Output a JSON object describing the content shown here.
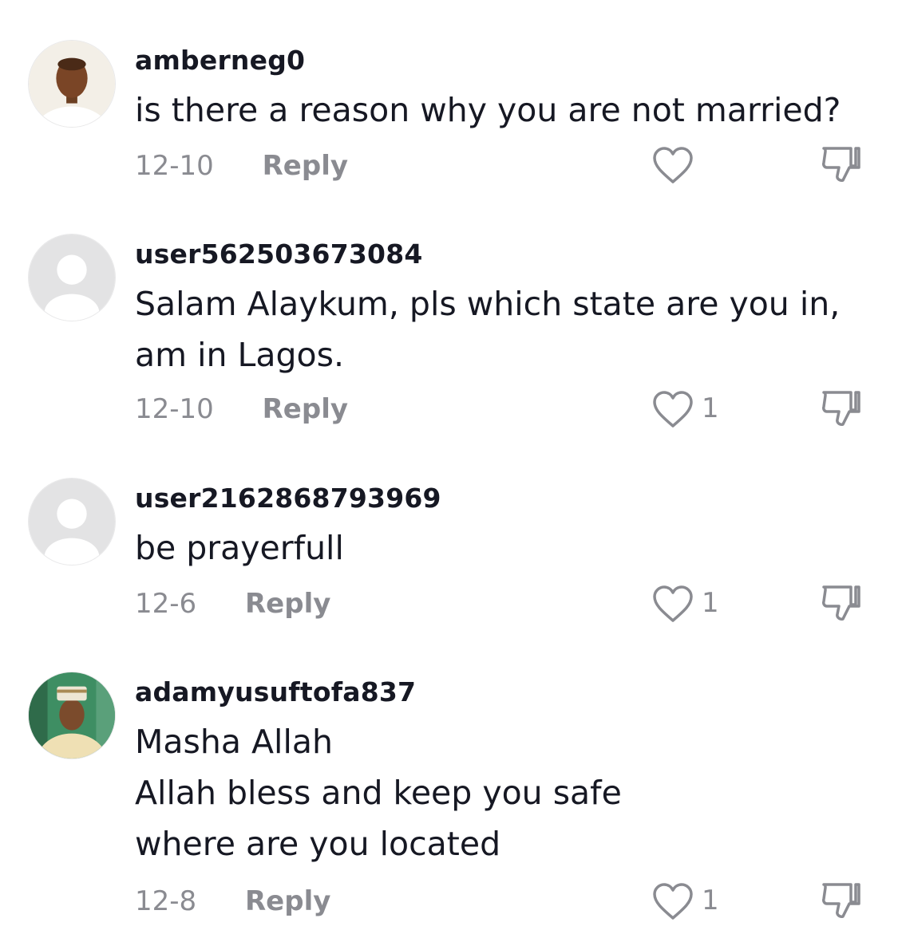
{
  "comments": [
    {
      "username": "amberneg0",
      "lines": [
        "is there a reason why you are not married?"
      ],
      "date": "12-10",
      "reply_label": "Reply",
      "likes": "",
      "avatar": "photo"
    },
    {
      "username": "user562503673084",
      "lines": [
        "Salam Alaykum, pls which state are you in,",
        "am in Lagos."
      ],
      "date": "12-10",
      "reply_label": "Reply",
      "likes": "1",
      "avatar": "default"
    },
    {
      "username": "user2162868793969",
      "lines": [
        "be prayerfull"
      ],
      "date": "12-6",
      "reply_label": "Reply",
      "likes": "1",
      "avatar": "default"
    },
    {
      "username": "adamyusuftofa837",
      "lines": [
        "Masha Allah",
        "Allah bless and keep you safe",
        "where are you located"
      ],
      "date": "12-8",
      "reply_label": "Reply",
      "likes": "1",
      "avatar": "photo"
    }
  ],
  "icons": {
    "like": "heart-outline-icon",
    "dislike": "thumbs-down-icon"
  },
  "colors": {
    "text": "#161823",
    "secondary": "#8a8b91",
    "icon": "#8a8b91"
  }
}
